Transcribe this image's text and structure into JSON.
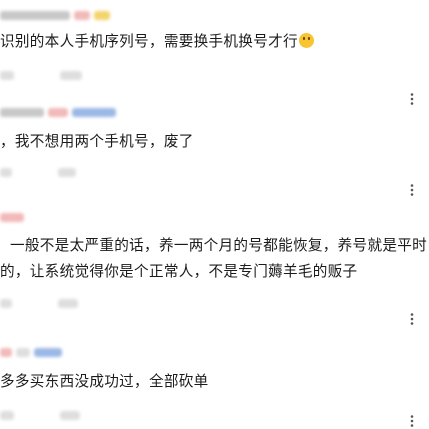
{
  "comments": [
    {
      "text": "识别的本人手机序列号，需要换手机换号才行",
      "emoji": "sweat-smile-emoji"
    },
    {
      "text": "，我不想用两个手机号，废了"
    },
    {
      "text_lines": [
        "一般不是太严重的话，养一两个月的号都能恢复，养号就是平时",
        "的，让系统觉得你是个正常人，不是专门薅羊毛的贩子"
      ]
    },
    {
      "text": "多多买东西没成功过，全部砍单"
    }
  ],
  "icons": {
    "more": "more-vertical-icon"
  }
}
